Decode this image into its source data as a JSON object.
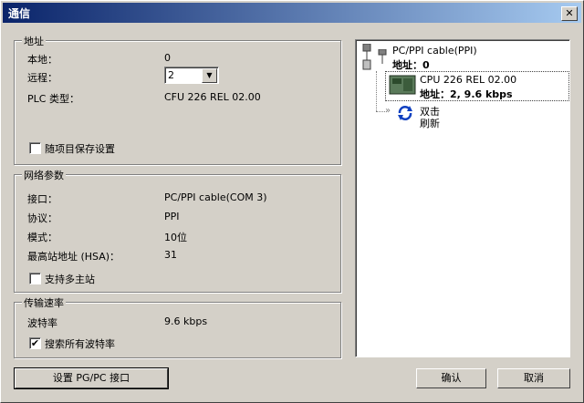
{
  "window": {
    "title": "通信",
    "close_icon": "close-icon"
  },
  "address_group": {
    "legend": "地址",
    "local_label": "本地：",
    "local_value": "0",
    "remote_label": "远程：",
    "remote_value": "2",
    "plc_type_label": "PLC 类型：",
    "plc_type_value": "CFU 226 REL 02.00",
    "save_with_project_label": "随项目保存设置",
    "save_with_project_checked": false
  },
  "network_group": {
    "legend": "网络参数",
    "interface_label": "接口：",
    "interface_value": "PC/PPI cable(COM 3)",
    "protocol_label": "协议：",
    "protocol_value": "PPI",
    "mode_label": "模式：",
    "mode_value": "10位",
    "hsa_label": "最高站地址 (HSA)：",
    "hsa_value": "31",
    "multi_master_label": "支持多主站",
    "multi_master_checked": false
  },
  "rate_group": {
    "legend": "传输速率",
    "baud_label": "波特率",
    "baud_value": "9.6 kbps",
    "search_all_label": "搜索所有波特率",
    "search_all_checked": true
  },
  "buttons": {
    "set_pgpc": "设置 PG/PC 接口",
    "ok": "确认",
    "cancel": "取消"
  },
  "tree": {
    "cable_title": "PC/PPI cable(PPI)",
    "cable_address": "地址：0",
    "cpu_title": "CPU 226 REL 02.00",
    "cpu_address": "地址：2, 9.6 kbps",
    "refresh_line1": "双击",
    "refresh_line2": "刷新"
  }
}
